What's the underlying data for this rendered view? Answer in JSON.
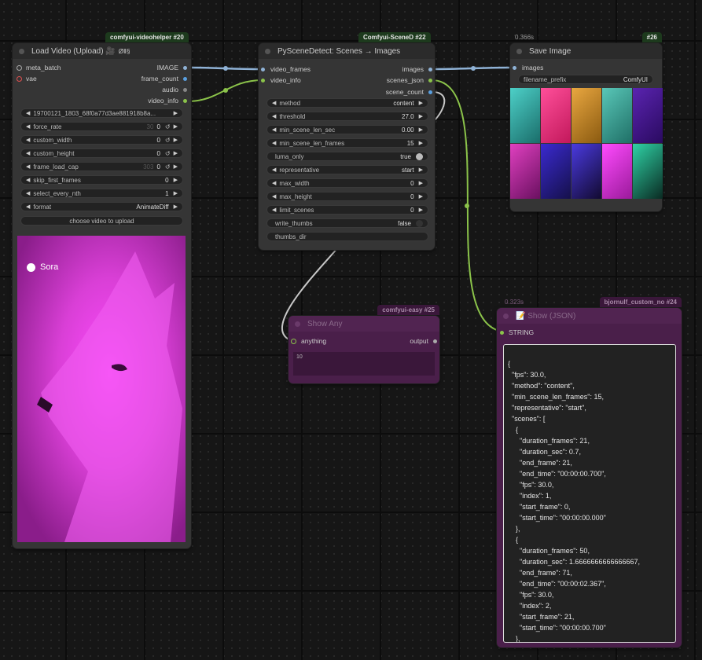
{
  "load_video": {
    "badge": "comfyui-videohelper #20",
    "title": "Load Video (Upload) 🎥",
    "badge_icons": "ØⅡ§",
    "inputs": [
      "meta_batch",
      "vae"
    ],
    "outputs": [
      "IMAGE",
      "frame_count",
      "audio",
      "video_info"
    ],
    "file": "19700121_1803_68f0a77d3ae881918b8a...",
    "widgets": [
      {
        "label": "force_rate",
        "hint": "30",
        "value": "0"
      },
      {
        "label": "custom_width",
        "hint": "",
        "value": "0"
      },
      {
        "label": "custom_height",
        "hint": "",
        "value": "0"
      },
      {
        "label": "frame_load_cap",
        "hint": "303",
        "value": "0"
      },
      {
        "label": "skip_first_frames",
        "hint": "",
        "value": "0"
      },
      {
        "label": "select_every_nth",
        "hint": "",
        "value": "1"
      },
      {
        "label": "format",
        "hint": "",
        "value": "AnimateDiff"
      }
    ],
    "upload_label": "choose video to upload",
    "preview_watermark": "Sora"
  },
  "scene_detect": {
    "badge": "Comfyui-SceneD  #22",
    "title": "PySceneDetect: Scenes → Images",
    "inputs": [
      "video_frames",
      "video_info"
    ],
    "outputs": [
      "images",
      "scenes_json",
      "scene_count"
    ],
    "widgets": [
      {
        "label": "method",
        "value": "content"
      },
      {
        "label": "threshold",
        "value": "27.0"
      },
      {
        "label": "min_scene_len_sec",
        "value": "0.00"
      },
      {
        "label": "min_scene_len_frames",
        "value": "15"
      },
      {
        "label": "luma_only",
        "value": "true"
      },
      {
        "label": "representative",
        "value": "start"
      },
      {
        "label": "max_width",
        "value": "0"
      },
      {
        "label": "max_height",
        "value": "0"
      },
      {
        "label": "limit_scenes",
        "value": "0"
      },
      {
        "label": "write_thumbs",
        "value": "false"
      },
      {
        "label": "thumbs_dir",
        "value": ""
      }
    ]
  },
  "save_image": {
    "time": "0.366s",
    "badge": "#26",
    "title": "Save Image",
    "input": "images",
    "prefix_label": "filename_prefix",
    "prefix_value": "ComfyUI"
  },
  "show_any": {
    "badge": "comfyui-easy #25",
    "title": "Show Any",
    "input": "anything",
    "output": "output",
    "value": "10"
  },
  "show_json": {
    "time": "0.323s",
    "badge": "bjornulf_custom_no #24",
    "title": "📝 Show (JSON)",
    "input": "STRING",
    "text": "{\n  \"fps\": 30.0,\n  \"method\": \"content\",\n  \"min_scene_len_frames\": 15,\n  \"representative\": \"start\",\n  \"scenes\": [\n    {\n      \"duration_frames\": 21,\n      \"duration_sec\": 0.7,\n      \"end_frame\": 21,\n      \"end_time\": \"00:00:00.700\",\n      \"fps\": 30.0,\n      \"index\": 1,\n      \"start_frame\": 0,\n      \"start_time\": \"00:00:00.000\"\n    },\n    {\n      \"duration_frames\": 50,\n      \"duration_sec\": 1.6666666666666667,\n      \"end_frame\": 71,\n      \"end_time\": \"00:00:02.367\",\n      \"fps\": 30.0,\n      \"index\": 2,\n      \"start_frame\": 21,\n      \"start_time\": \"00:00:00.700\"\n    },"
  },
  "colors": {
    "accent_green": "#8bc34a",
    "link_blue": "#8fb2d6",
    "magenta": "#e040e0"
  }
}
